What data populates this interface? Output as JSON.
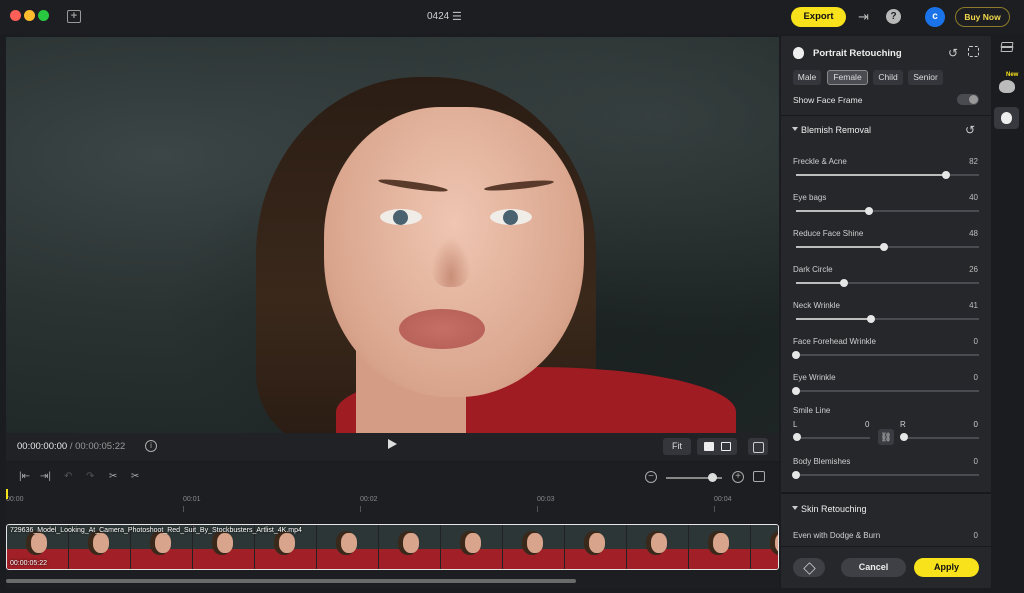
{
  "window": {
    "title": "0424"
  },
  "header": {
    "export_label": "Export",
    "avatar_initial": "c",
    "buy_label": "Buy Now"
  },
  "player": {
    "current_time": "00:00:00:00",
    "total_time": "/ 00:00:05:22",
    "fit_label": "Fit"
  },
  "timeline": {
    "ticks": [
      "00:00",
      "00:01",
      "00:02",
      "00:03",
      "00:04"
    ],
    "clip_name": "729636_Model_Looking_At_Camera_Photoshoot_Red_Suit_By_Stockbusters_Artlist_4K.mp4",
    "clip_duration": "00:00:05:22",
    "zoom_level": 0.75
  },
  "panel": {
    "title": "Portrait Retouching",
    "segments": [
      "Male",
      "Female",
      "Child",
      "Senior"
    ],
    "active_segment": "Female",
    "show_face_frame_label": "Show Face Frame",
    "show_face_frame": false,
    "blemish_section": "Blemish Removal",
    "sliders": [
      {
        "label": "Freckle & Acne",
        "value": 82
      },
      {
        "label": "Eye bags",
        "value": 40
      },
      {
        "label": "Reduce Face Shine",
        "value": 48
      },
      {
        "label": "Dark Circle",
        "value": 26
      },
      {
        "label": "Neck Wrinkle",
        "value": 41
      },
      {
        "label": "Face Forehead Wrinkle",
        "value": 0
      },
      {
        "label": "Eye Wrinkle",
        "value": 0
      }
    ],
    "smile_line": {
      "label": "Smile Line",
      "left_label": "L",
      "left_value": 0,
      "right_label": "R",
      "right_value": 0
    },
    "body_blemishes": {
      "label": "Body Blemishes",
      "value": 0
    },
    "skin_section": "Skin Retouching",
    "dodge_burn": {
      "label": "Even with Dodge & Burn",
      "value": 0
    },
    "cancel_label": "Cancel",
    "apply_label": "Apply"
  },
  "rail": {
    "new_badge": "New"
  },
  "colors": {
    "accent": "#f8e21c",
    "avatar": "#1a73e8",
    "panel_bg": "#26272b"
  }
}
